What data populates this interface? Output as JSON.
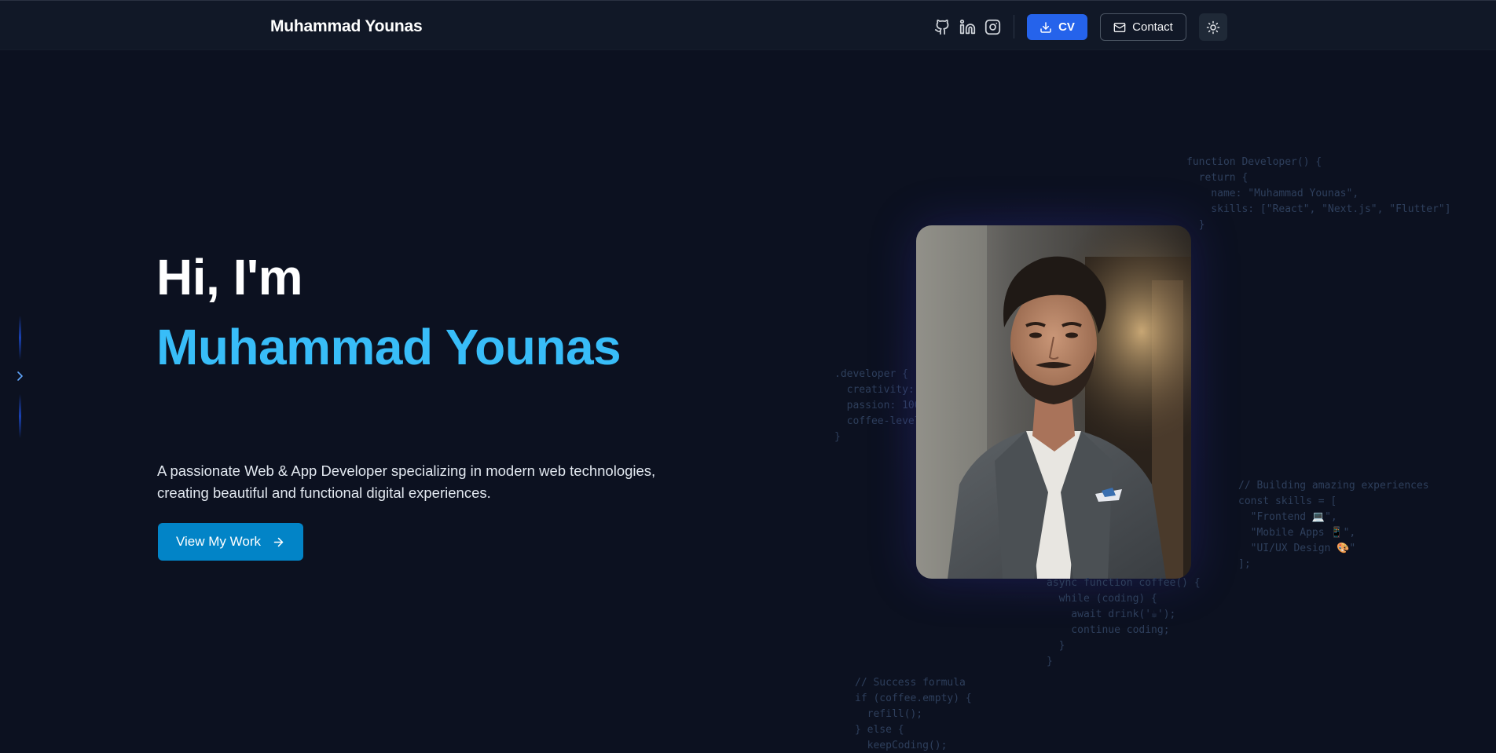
{
  "header": {
    "brand": "Muhammad Younas",
    "social": [
      "github-icon",
      "linkedin-icon",
      "instagram-icon"
    ],
    "cv_label": "CV",
    "contact_label": "Contact",
    "theme_icon": "sun-icon"
  },
  "hero": {
    "greeting": "Hi, I'm",
    "name": "Muhammad Younas",
    "description_line1": "A passionate Web & App Developer specializing in modern web technologies,",
    "description_line2": "creating beautiful and functional digital experiences.",
    "cta_label": "View My Work"
  },
  "code_snippets": {
    "snippet1": "function Developer() {\n  return {\n    name: \"Muhammad Younas\",\n    skills: [\"React\", \"Next.js\", \"Flutter\"]\n  }",
    "snippet2": ".developer {\n  creativity: \n  passion: 100\n  coffee-level\n}",
    "snippet3": "// Building amazing experiences\nconst skills = [\n  \"Frontend 💻\",\n  \"Mobile Apps 📱\",\n  \"UI/UX Design 🎨\"\n];",
    "snippet4": "async function coffee() {\n  while (coding) {\n    await drink('☕');\n    continue coding;\n  }\n}",
    "snippet5": "// Success formula\nif (coffee.empty) {\n  refill();\n} else {\n  keepCoding();"
  },
  "colors": {
    "background": "#0c1120",
    "navbar": "#111827",
    "accent_name": "#38bdf8",
    "cv_button": "#2563eb",
    "cta_button": "#0284c7"
  }
}
